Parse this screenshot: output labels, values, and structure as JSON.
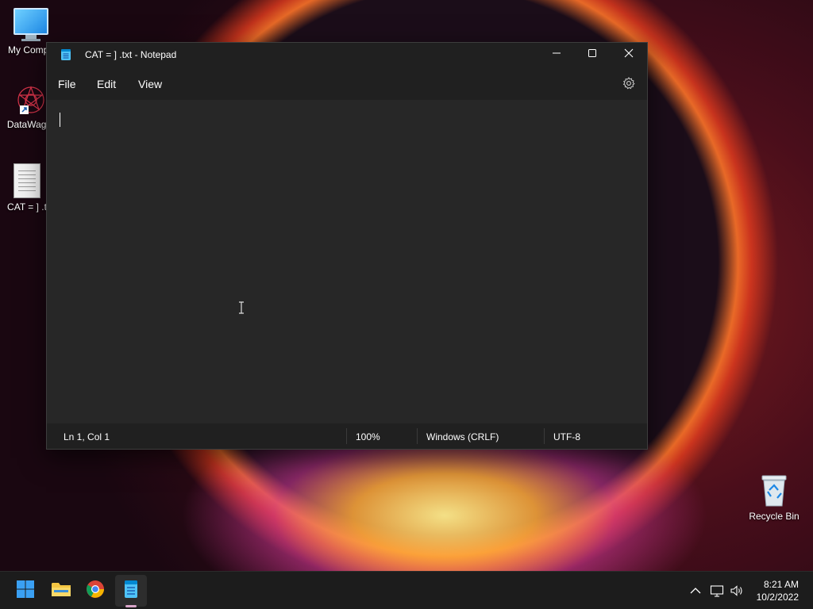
{
  "desktop": {
    "icons": [
      {
        "label": "My Compu"
      },
      {
        "label": "DataWago"
      },
      {
        "label": "CAT = ] .t"
      },
      {
        "label": "Recycle Bin"
      }
    ]
  },
  "window": {
    "title": "CAT = ] .txt - Notepad",
    "menu": [
      "File",
      "Edit",
      "View"
    ],
    "status": {
      "position": "Ln 1, Col 1",
      "zoom": "100%",
      "line_ending": "Windows (CRLF)",
      "encoding": "UTF-8"
    }
  },
  "taskbar": {
    "time": "8:21 AM",
    "date": "10/2/2022"
  }
}
